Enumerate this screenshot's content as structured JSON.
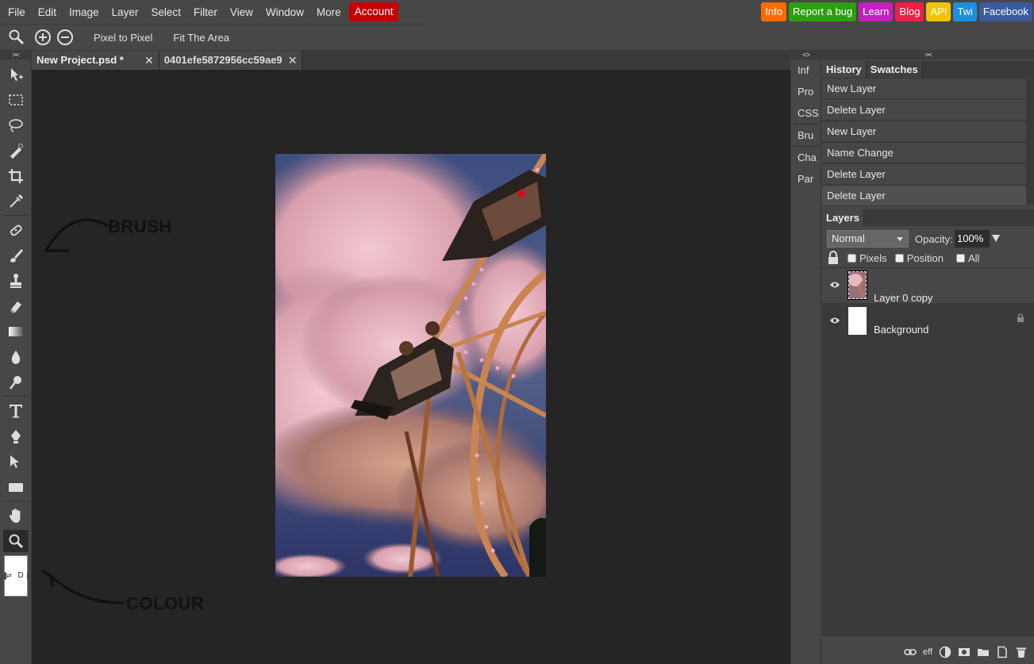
{
  "menu": [
    "File",
    "Edit",
    "Image",
    "Layer",
    "Select",
    "Filter",
    "View",
    "Window",
    "More"
  ],
  "account_label": "Account",
  "links": [
    {
      "label": "Info",
      "color": "#ff6a00"
    },
    {
      "label": "Report a bug",
      "color": "#2e9e12"
    },
    {
      "label": "Learn",
      "color": "#c41fbf"
    },
    {
      "label": "Blog",
      "color": "#ee1f48"
    },
    {
      "label": "API",
      "color": "#f2c500"
    },
    {
      "label": "Twi",
      "color": "#1d8fe0"
    },
    {
      "label": "Facebook",
      "color": "#3b5b9e"
    }
  ],
  "options": {
    "pixel_to_pixel": "Pixel to Pixel",
    "fit_area": "Fit The Area"
  },
  "tabs": [
    {
      "label": "New Project.psd *"
    },
    {
      "label": "0401efe5872956cc59ae9"
    }
  ],
  "annotations": {
    "brush": "BRUSH",
    "colour": "COLOUR"
  },
  "collapse_glyph": "><",
  "expand_glyph": "<>",
  "mini_panel": [
    "Inf",
    "Pro",
    "CSS",
    "Bru",
    "Cha",
    "Par"
  ],
  "panel_tabs": {
    "history": "History",
    "swatches": "Swatches",
    "layers": "Layers"
  },
  "history": [
    "New Layer",
    "Delete Layer",
    "New Layer",
    "Name Change",
    "Delete Layer",
    "Delete Layer"
  ],
  "layers_panel": {
    "blend_mode": "Normal",
    "opacity_label": "Opacity:",
    "opacity_value": "100%",
    "lock_pixels": "Pixels",
    "lock_position": "Position",
    "lock_all": "All",
    "layers": [
      {
        "name": "Layer 0 copy"
      },
      {
        "name": "Background"
      }
    ],
    "footer_eff": "eff"
  },
  "colors_swap_label": "D"
}
